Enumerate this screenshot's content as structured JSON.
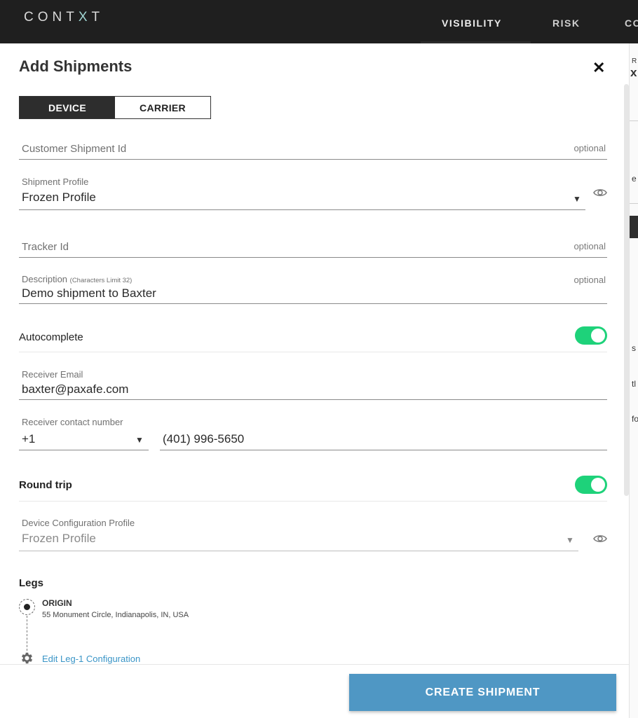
{
  "topbar": {
    "logo": {
      "pre": "CONT",
      "x": "X",
      "post": "T"
    },
    "nav": [
      {
        "label": "VISIBILITY"
      },
      {
        "label": "RISK"
      },
      {
        "label": "CO"
      }
    ]
  },
  "background_fragments": [
    "R",
    "x",
    "e",
    "s",
    "tl",
    "fo"
  ],
  "modal": {
    "title": "Add Shipments",
    "close_icon": "close-icon",
    "tabs": [
      {
        "label": "DEVICE",
        "active": true
      },
      {
        "label": "CARRIER",
        "active": false
      }
    ],
    "customer_shipment_id": {
      "placeholder": "Customer Shipment Id",
      "optional": "optional"
    },
    "shipment_profile": {
      "label": "Shipment Profile",
      "value": "Frozen Profile",
      "arrow": "▼"
    },
    "tracker_id": {
      "placeholder": "Tracker Id",
      "optional": "optional"
    },
    "description": {
      "label": "Description",
      "limit": "(Characters Limit 32)",
      "value": "Demo shipment to Baxter",
      "optional": "optional"
    },
    "autocomplete": {
      "label": "Autocomplete",
      "on": true
    },
    "receiver_email": {
      "label": "Receiver Email",
      "value": "baxter@paxafe.com"
    },
    "receiver_contact": {
      "label": "Receiver contact number",
      "country_code": "+1",
      "arrow": "▼",
      "number": "(401) 996-5650"
    },
    "round_trip": {
      "label": "Round trip",
      "on": true
    },
    "device_config": {
      "label": "Device Configuration Profile",
      "value": "Frozen Profile",
      "arrow": "▼"
    },
    "legs": {
      "title": "Legs",
      "origin_label": "ORIGIN",
      "origin_address": "55 Monument Circle, Indianapolis, IN, USA",
      "edit_link": "Edit Leg-1 Configuration"
    },
    "create_button": "CREATE SHIPMENT"
  },
  "colors": {
    "topbar": "#1f1f1f",
    "toggle_on": "#1ed27a",
    "primary_button": "#4f97c4",
    "link": "#3a95c7"
  }
}
